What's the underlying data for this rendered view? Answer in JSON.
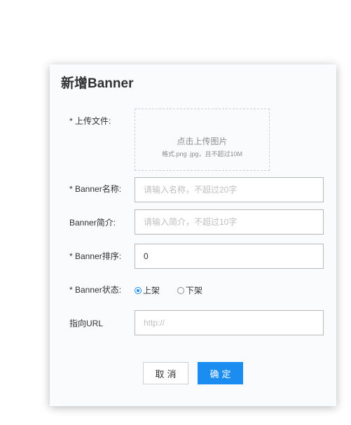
{
  "dialog": {
    "title": "新增Banner"
  },
  "form": {
    "upload": {
      "label": "* 上传文件:",
      "button_text": "点击上传图片",
      "hint": "格式.png .jpg，且不超过10M"
    },
    "name": {
      "label": "* Banner名称:",
      "value": "",
      "placeholder": "请输入名称，不超过20字"
    },
    "intro": {
      "label": "Banner简介:",
      "value": "",
      "placeholder": "请输入简介，不超过10字"
    },
    "order": {
      "label": "* Banner排序:",
      "value": "0",
      "placeholder": ""
    },
    "status": {
      "label": "* Banner状态:",
      "options": [
        "上架",
        "下架"
      ],
      "selected": "上架"
    },
    "url": {
      "label": "指向URL",
      "value": "",
      "placeholder": "http://"
    }
  },
  "actions": {
    "cancel_label": "取消",
    "confirm_label": "确定"
  },
  "colors": {
    "primary": "#1b8cf0",
    "dialog_bg": "#fafbfd"
  }
}
